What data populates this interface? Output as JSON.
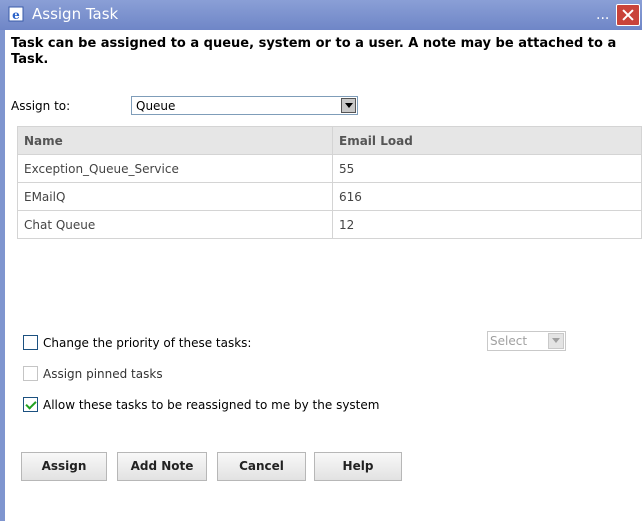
{
  "window": {
    "title": "Assign Task",
    "title_dots": "..."
  },
  "description": "Task can be assigned to a queue, system or to a user. A note may be attached to a Task.",
  "assign_to": {
    "label": "Assign to:",
    "selected": "Queue"
  },
  "table": {
    "columns": [
      "Name",
      "Email Load"
    ],
    "rows": [
      [
        "Exception_Queue_Service",
        "55"
      ],
      [
        "EMailQ",
        "616"
      ],
      [
        "Chat Queue",
        "12"
      ]
    ]
  },
  "options": {
    "change_priority": {
      "label": "Change the priority of these tasks:",
      "checked": false
    },
    "priority_select": "Select",
    "assign_pinned": {
      "label": "Assign pinned tasks",
      "checked": false,
      "enabled": false
    },
    "allow_reassign": {
      "label": "Allow these tasks to be reassigned to me by the system",
      "checked": true
    }
  },
  "buttons": {
    "assign": "Assign",
    "add_note": "Add Note",
    "cancel": "Cancel",
    "help": "Help"
  },
  "colors": {
    "titlebar": "#7a8fd0",
    "close": "#c9433a",
    "check": "#21a121"
  }
}
